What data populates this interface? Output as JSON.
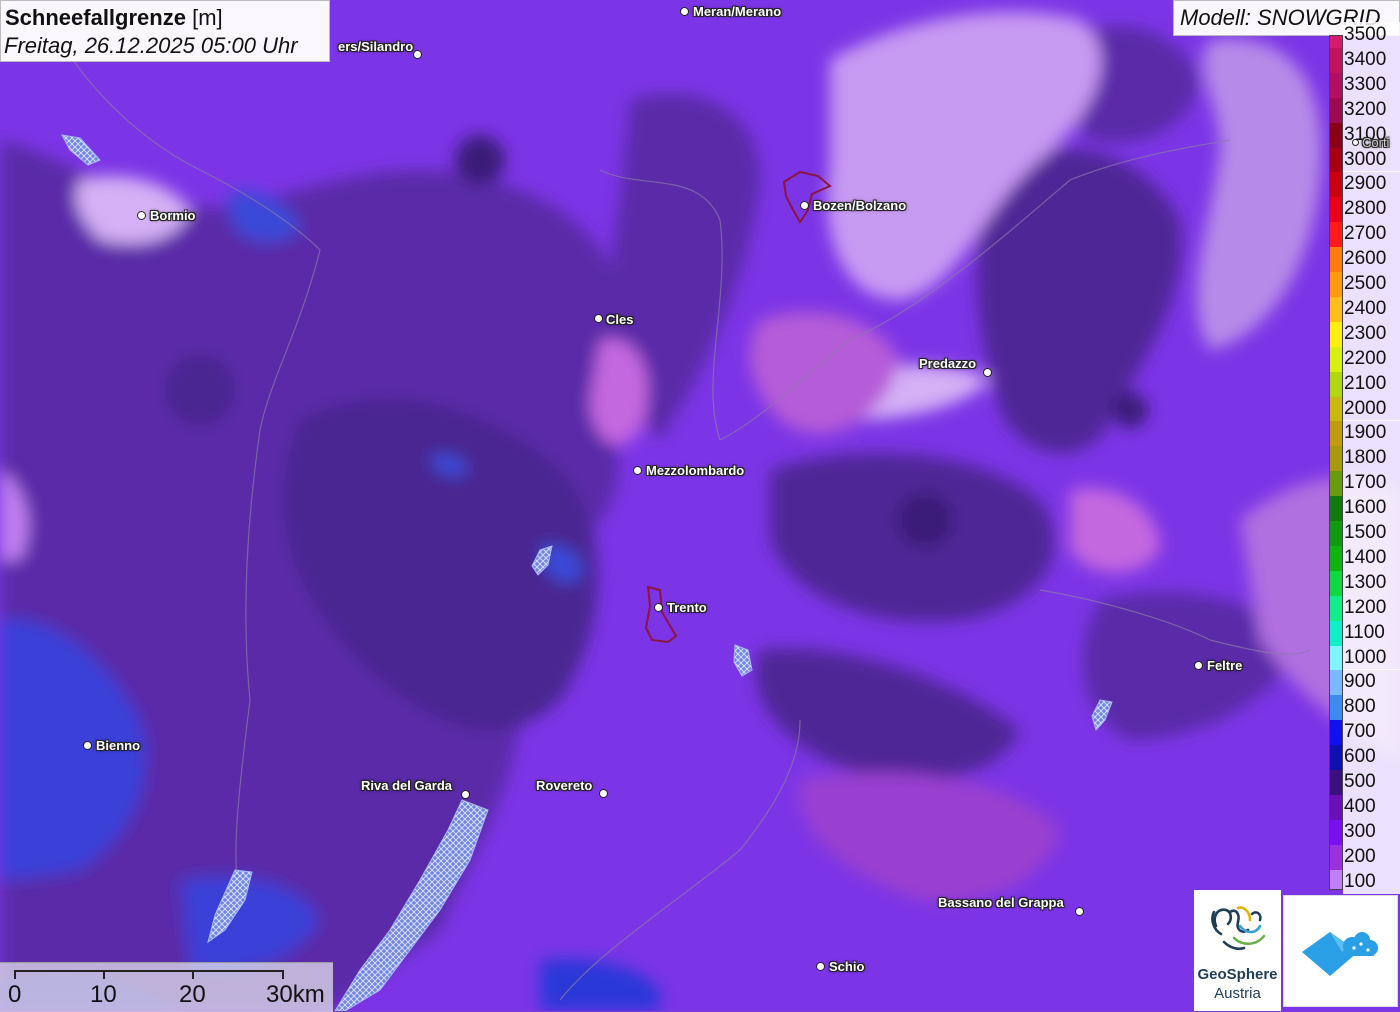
{
  "title": {
    "parameter": "Schneefallgrenze",
    "unit": "[m]",
    "datetime": "Freitag, 26.12.2025 05:00 Uhr"
  },
  "model_label": "Modell: SNOWGRID",
  "legend": [
    {
      "label": "3500",
      "color": "#d61a6e"
    },
    {
      "label": "3400",
      "color": "#c4125e"
    },
    {
      "label": "3300",
      "color": "#b20e62"
    },
    {
      "label": "3200",
      "color": "#9c0a52"
    },
    {
      "label": "3100",
      "color": "#8a0016"
    },
    {
      "label": "3000",
      "color": "#a80010"
    },
    {
      "label": "2900",
      "color": "#c80010"
    },
    {
      "label": "2800",
      "color": "#e8001a"
    },
    {
      "label": "2700",
      "color": "#ff1a1a"
    },
    {
      "label": "2600",
      "color": "#ff7a10"
    },
    {
      "label": "2500",
      "color": "#ff9a10"
    },
    {
      "label": "2400",
      "color": "#ffbe1a"
    },
    {
      "label": "2300",
      "color": "#ffee10"
    },
    {
      "label": "2200",
      "color": "#d6f010"
    },
    {
      "label": "2100",
      "color": "#b0d810"
    },
    {
      "label": "2000",
      "color": "#c8b810"
    },
    {
      "label": "1900",
      "color": "#c09a10"
    },
    {
      "label": "1800",
      "color": "#a89a10"
    },
    {
      "label": "1700",
      "color": "#6a9a10"
    },
    {
      "label": "1600",
      "color": "#107a10"
    },
    {
      "label": "1500",
      "color": "#109a10"
    },
    {
      "label": "1400",
      "color": "#10b410"
    },
    {
      "label": "1300",
      "color": "#10d840"
    },
    {
      "label": "1200",
      "color": "#10ee8a"
    },
    {
      "label": "1100",
      "color": "#10f0c8"
    },
    {
      "label": "1000",
      "color": "#80f4ff"
    },
    {
      "label": "900",
      "color": "#7ab8ff"
    },
    {
      "label": "800",
      "color": "#3a8cf0"
    },
    {
      "label": "700",
      "color": "#1010f0"
    },
    {
      "label": "600",
      "color": "#1010b0"
    },
    {
      "label": "500",
      "color": "#3a1080"
    },
    {
      "label": "400",
      "color": "#6a10b8"
    },
    {
      "label": "300",
      "color": "#7a10f0"
    },
    {
      "label": "200",
      "color": "#9a30e0"
    },
    {
      "label": "100",
      "color": "#c080f8"
    }
  ],
  "cities": [
    {
      "name": "Meran/Merano"
    },
    {
      "name": "ers/Silandro"
    },
    {
      "name": "Bormio"
    },
    {
      "name": "Bozen/Bolzano"
    },
    {
      "name": "Cles"
    },
    {
      "name": "Predazzo"
    },
    {
      "name": "Mezzolombardo"
    },
    {
      "name": "Trento"
    },
    {
      "name": "Feltre"
    },
    {
      "name": "Bienno"
    },
    {
      "name": "Riva del Garda"
    },
    {
      "name": "Rovereto"
    },
    {
      "name": "Bassano del Grappa"
    },
    {
      "name": "Schio"
    },
    {
      "name": "Corti"
    }
  ],
  "scale_bar": {
    "labels": [
      "0",
      "10",
      "20",
      "30km"
    ]
  },
  "logos": {
    "geosphere_line1": "GeoSphere",
    "geosphere_line2": "Austria"
  }
}
